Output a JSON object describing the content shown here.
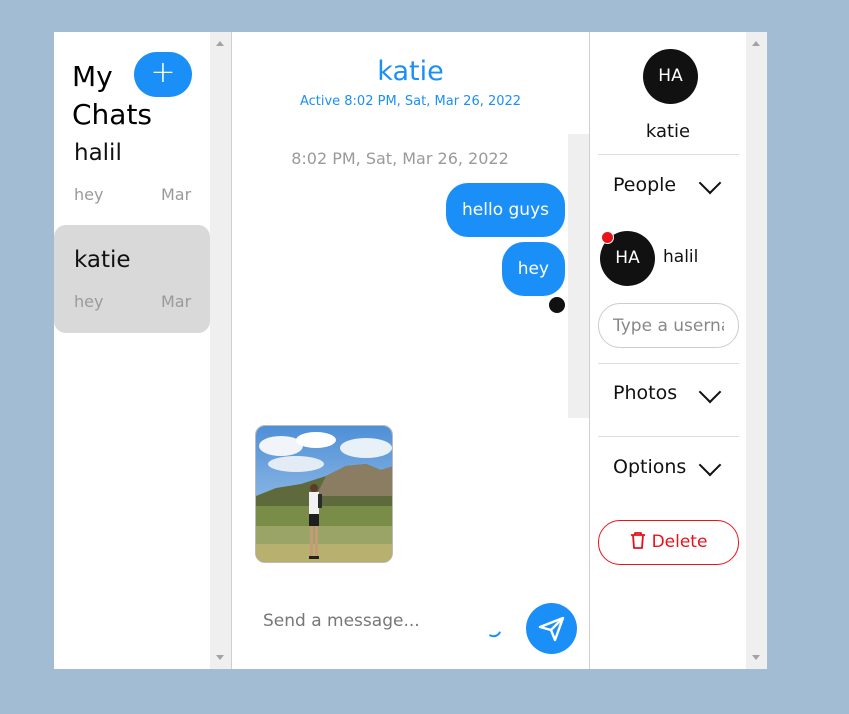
{
  "sidebar": {
    "heading": "My Chats",
    "new_chat_label": "+",
    "chats": [
      {
        "title": "halil",
        "last_message": "hey",
        "time": "Mar"
      },
      {
        "title": "katie",
        "last_message": "hey",
        "time": "Mar"
      }
    ]
  },
  "conversation": {
    "title": "katie",
    "active_status": "Active 8:02 PM, Sat, Mar 26, 2022",
    "date_separator": "8:02 PM, Sat, Mar 26, 2022",
    "messages": [
      {
        "text": "hello guys"
      },
      {
        "text": "hey"
      }
    ],
    "compose_placeholder": "Send a message...",
    "icons": {
      "send": "send-icon",
      "attach": "attach-icon"
    }
  },
  "details": {
    "avatar_initials": "HA",
    "name": "katie",
    "people_label": "People",
    "people": [
      {
        "initials": "HA",
        "name": "halil"
      }
    ],
    "username_placeholder": "Type a username",
    "photos_label": "Photos",
    "options_label": "Options",
    "delete_label": "Delete"
  },
  "colors": {
    "accent": "#1b8ff8",
    "danger": "#e8121b",
    "background": "#a2bcd4",
    "selected_chat": "#d9d9d9"
  }
}
